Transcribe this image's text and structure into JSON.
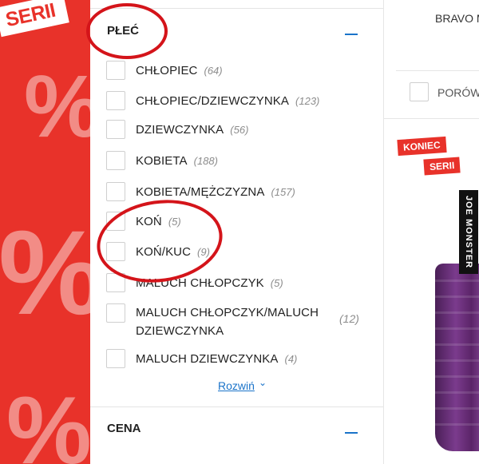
{
  "promo": {
    "tag_label": "SERII",
    "percent_symbol": "%"
  },
  "filter": {
    "header": "PŁEĆ",
    "options": [
      {
        "label": "CHŁOPIEC",
        "count": "(64)"
      },
      {
        "label": "CHŁOPIEC/DZIEWCZYNKA",
        "count": "(123)"
      },
      {
        "label": "DZIEWCZYNKA",
        "count": "(56)"
      },
      {
        "label": "KOBIETA",
        "count": "(188)"
      },
      {
        "label": "KOBIETA/MĘŻCZYZNA",
        "count": "(157)"
      },
      {
        "label": "KOŃ",
        "count": "(5)"
      },
      {
        "label": "KOŃ/KUC",
        "count": "(9)"
      },
      {
        "label": "MALUCH CHŁOPCZYK",
        "count": "(5)"
      },
      {
        "label_line1": "MALUCH CHŁOPCZYK/MALUCH",
        "label_line2": "DZIEWCZYNKA",
        "count": "(12)"
      },
      {
        "label": "MALUCH DZIEWCZYNKA",
        "count": "(4)"
      }
    ],
    "expand_label": "Rozwiń",
    "next_section": "CENA"
  },
  "product": {
    "brand_text": "BRAVO MA",
    "compare_label": "PORÓWN",
    "badge_line1": "KONIEC",
    "badge_line2": "SERII"
  },
  "watermark": "JOE MONSTER",
  "colors": {
    "promo_red": "#e8322a",
    "accent_blue": "#1a73c9",
    "circle_red": "#d4141a",
    "garment_purple": "#6a2f7a"
  }
}
